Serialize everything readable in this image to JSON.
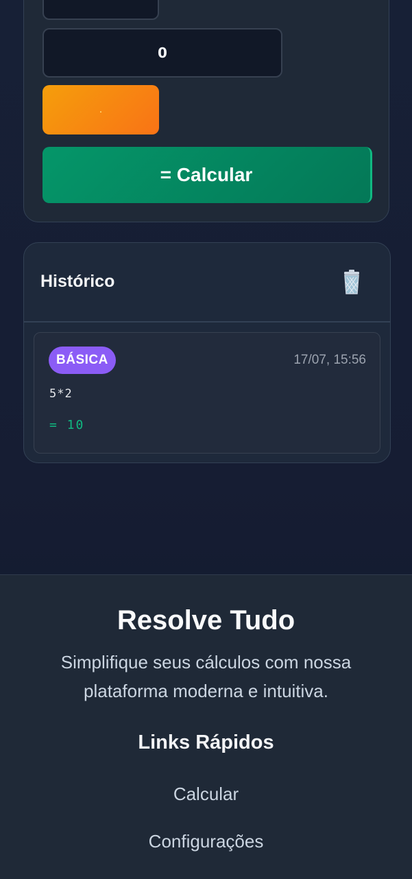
{
  "calculator": {
    "top_key_label": "",
    "display_value": "0",
    "dot_key_label": ".",
    "calculate_button_label": "= Calcular"
  },
  "history": {
    "title": "Histórico",
    "clear_icon": "trash-icon",
    "items": [
      {
        "badge": "BÁSICA",
        "timestamp": "17/07, 15:56",
        "expression": "5*2",
        "result": "= 10"
      }
    ]
  },
  "footer": {
    "title": "Resolve Tudo",
    "description": "Simplifique seus cálculos com nossa plataforma moderna e intuitiva.",
    "links_title": "Links Rápidos",
    "links": [
      "Calcular",
      "Configurações"
    ]
  },
  "colors": {
    "accent_green": "#059669",
    "accent_orange": "#f59e0b",
    "badge_purple": "#8b5cf6",
    "result_green": "#10b981"
  }
}
